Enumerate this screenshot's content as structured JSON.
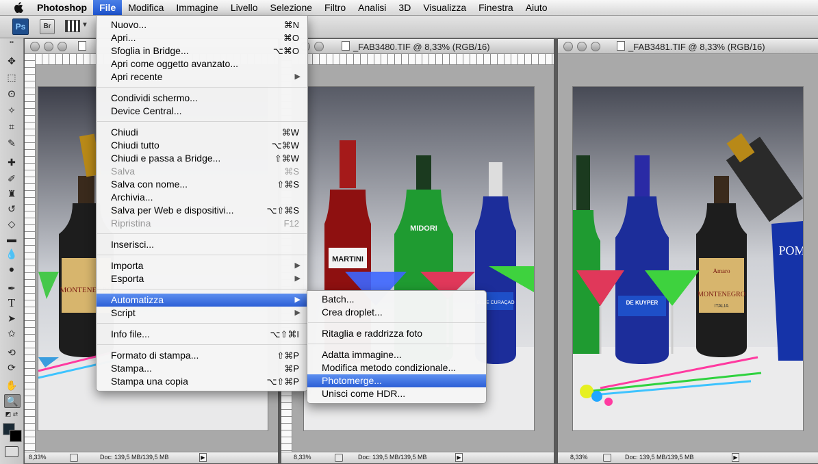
{
  "menubar": {
    "app": "Photoshop",
    "items": [
      "File",
      "Modifica",
      "Immagine",
      "Livello",
      "Selezione",
      "Filtro",
      "Analisi",
      "3D",
      "Visualizza",
      "Finestra",
      "Aiuto"
    ]
  },
  "optionsbar": {
    "ps_label": "Ps",
    "br_label": "Br"
  },
  "windows": [
    {
      "title": "",
      "zoom": "8,33%",
      "doc": "Doc: 139,5 MB/139,5 MB"
    },
    {
      "title": "_FAB3480.TIF @ 8,33% (RGB/16)",
      "zoom": "8,33%",
      "doc": "Doc: 139,5 MB/139,5 MB"
    },
    {
      "title": "_FAB3481.TIF @ 8,33% (RGB/16)",
      "zoom": "8,33%",
      "doc": "Doc: 139,5 MB/139,5 MB"
    }
  ],
  "file_menu": {
    "items": [
      {
        "label": "Nuovo...",
        "shortcut": "⌘N"
      },
      {
        "label": "Apri...",
        "shortcut": "⌘O"
      },
      {
        "label": "Sfoglia in Bridge...",
        "shortcut": "⌥⌘O"
      },
      {
        "label": "Apri come oggetto avanzato...",
        "shortcut": ""
      },
      {
        "label": "Apri recente",
        "shortcut": ""
      },
      {
        "label": "Condividi schermo...",
        "shortcut": ""
      },
      {
        "label": "Device Central...",
        "shortcut": ""
      },
      {
        "label": "Chiudi",
        "shortcut": "⌘W"
      },
      {
        "label": "Chiudi tutto",
        "shortcut": "⌥⌘W"
      },
      {
        "label": "Chiudi e passa a Bridge...",
        "shortcut": "⇧⌘W"
      },
      {
        "label": "Salva",
        "shortcut": "⌘S"
      },
      {
        "label": "Salva con nome...",
        "shortcut": "⇧⌘S"
      },
      {
        "label": "Archivia...",
        "shortcut": ""
      },
      {
        "label": "Salva per Web e dispositivi...",
        "shortcut": "⌥⇧⌘S"
      },
      {
        "label": "Ripristina",
        "shortcut": "F12"
      },
      {
        "label": "Inserisci...",
        "shortcut": ""
      },
      {
        "label": "Importa",
        "shortcut": ""
      },
      {
        "label": "Esporta",
        "shortcut": ""
      },
      {
        "label": "Automatizza",
        "shortcut": ""
      },
      {
        "label": "Script",
        "shortcut": ""
      },
      {
        "label": "Info file...",
        "shortcut": "⌥⇧⌘I"
      },
      {
        "label": "Formato di stampa...",
        "shortcut": "⇧⌘P"
      },
      {
        "label": "Stampa...",
        "shortcut": "⌘P"
      },
      {
        "label": "Stampa una copia",
        "shortcut": "⌥⇧⌘P"
      }
    ]
  },
  "automate_menu": {
    "items": [
      "Batch...",
      "Crea droplet...",
      "Ritaglia e raddrizza foto",
      "Adatta immagine...",
      "Modifica metodo condizionale...",
      "Photomerge...",
      "Unisci come HDR..."
    ]
  },
  "photo_text": {
    "martini": "MARTINI",
    "midori": "MIDORI",
    "curacao": "BLUE CURAÇAO",
    "dekuyper": "DE KUYPER",
    "montenegro": "MONTENEGRO",
    "amaro": "Amaro",
    "italia": "ITALIA",
    "pom": "POM"
  }
}
